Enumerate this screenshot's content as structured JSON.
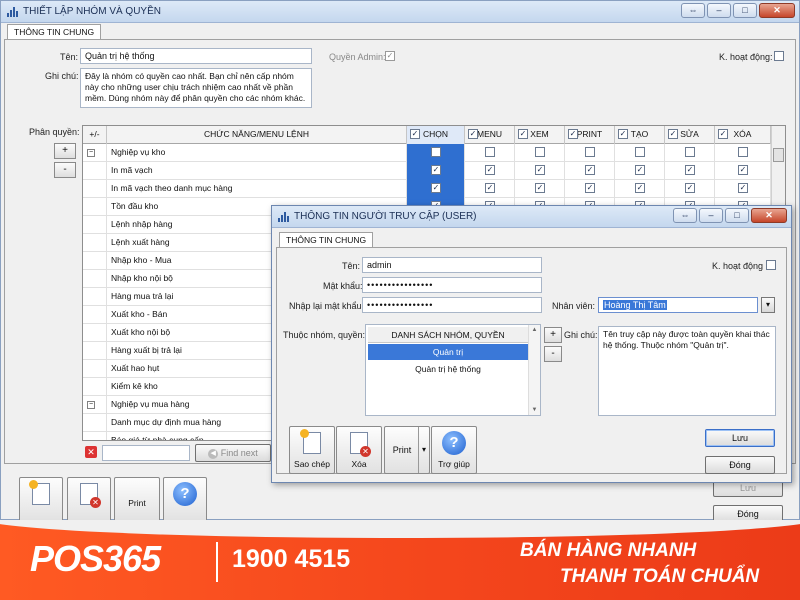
{
  "main": {
    "title": "THIẾT LẬP NHÓM VÀ QUYỀN",
    "tab": "THÔNG TIN CHUNG",
    "name_label": "Tên:",
    "name_value": "Quản trị hệ thống",
    "admin_label": "Quyền Admin:",
    "active_label": "K. hoạt động:",
    "note_label": "Ghi chú:",
    "note_value": "Đây là nhóm có quyền cao nhất. Bạn chỉ nên cấp nhóm này cho những user chịu trách nhiệm cao nhất về phần mềm. Dùng nhóm này để phân quyền cho các nhóm khác.",
    "perm_label": "Phân quyền:",
    "plus": "+",
    "minus": "-",
    "find_next": "Find next",
    "print": "Print",
    "save": "Lưu",
    "close": "Đóng"
  },
  "grid": {
    "headers": {
      "expand": "+/-",
      "function": "CHỨC NĂNG/MENU LỆNH",
      "select": "CHỌN",
      "menu": "MENU",
      "view": "XEM",
      "print": "PRINT",
      "create": "TẠO",
      "edit": "SỬA",
      "delete": "XÓA"
    },
    "rows": [
      {
        "label": "Nghiệp vụ kho",
        "group": true,
        "checked": false
      },
      {
        "label": "In mã vạch",
        "group": false,
        "checked": true
      },
      {
        "label": "In mã vạch theo danh mục hàng",
        "group": false,
        "checked": true
      },
      {
        "label": "Tồn đầu kho",
        "group": false,
        "checked": true
      },
      {
        "label": "Lệnh nhập hàng",
        "group": false,
        "checked": true
      },
      {
        "label": "Lệnh xuất hàng",
        "group": false,
        "checked": true
      },
      {
        "label": "Nhập kho - Mua",
        "group": false,
        "checked": true
      },
      {
        "label": "Nhập kho nội bộ",
        "group": false,
        "checked": true
      },
      {
        "label": "Hàng mua trả lại",
        "group": false,
        "checked": true
      },
      {
        "label": "Xuất kho - Bán",
        "group": false,
        "checked": true
      },
      {
        "label": "Xuất kho nội bộ",
        "group": false,
        "checked": true
      },
      {
        "label": "Hàng xuất bị trả lại",
        "group": false,
        "checked": true
      },
      {
        "label": "Xuất hao hụt",
        "group": false,
        "checked": true
      },
      {
        "label": "Kiểm kê kho",
        "group": false,
        "checked": true
      },
      {
        "label": "Nghiệp vụ mua hàng",
        "group": true,
        "checked": false
      },
      {
        "label": "Danh mục dự định mua hàng",
        "group": false,
        "checked": true
      },
      {
        "label": "Báo giá từ nhà cung cấp",
        "group": false,
        "checked": true
      }
    ]
  },
  "dialog": {
    "title": "THÔNG TIN NGƯỜI TRUY CẬP (USER)",
    "tab": "THÔNG TIN CHUNG",
    "name_label": "Tên:",
    "name_value": "admin",
    "password_label": "Mật khẩu:",
    "password_value": "••••••••••••••••",
    "repassword_label": "Nhập lại mật khẩu:",
    "repassword_value": "••••••••••••••••",
    "active_label": "K. hoạt động",
    "employee_label": "Nhân viên:",
    "employee_value": "Hoàng Thị Tâm",
    "group_label": "Thuộc nhóm, quyền:",
    "list_header": "DANH SÁCH NHÓM, QUYỀN",
    "groups": [
      "Quản trị",
      "Quản trị hệ thống"
    ],
    "note_label": "Ghi chú:",
    "note_value": "Tên truy cập này được toàn quyền khai thác hệ thống. Thuộc nhóm \"Quản trị\".",
    "plus": "+",
    "minus": "-",
    "copy": "Sao chép",
    "delete": "Xóa",
    "print": "Print",
    "help": "Trợ giúp",
    "save": "Lưu",
    "close": "Đóng"
  },
  "banner": {
    "logo": "POS365",
    "phone": "1900 4515",
    "slogan1": "BÁN HÀNG NHANH",
    "slogan2": "THANH TOÁN CHUẨN"
  },
  "colors": {
    "accent": "#2f6fd0",
    "banner": "#f4461c"
  },
  "icons": {
    "copy": "document-new-icon",
    "delete": "document-delete-icon",
    "help": "help-icon"
  }
}
